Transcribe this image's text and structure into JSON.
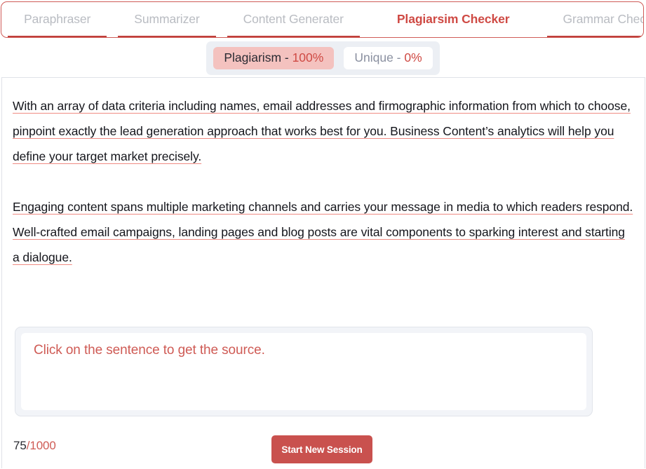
{
  "tabs": [
    {
      "label": "Paraphraser",
      "active": false
    },
    {
      "label": "Summarizer",
      "active": false
    },
    {
      "label": "Content Generater",
      "active": false
    },
    {
      "label": "Plagiarsim Checker",
      "active": true
    },
    {
      "label": "Grammar Checker",
      "active": false
    }
  ],
  "scores": {
    "plagiarism_label": "Plagiarism - ",
    "plagiarism_value": "100%",
    "unique_label": "Unique - ",
    "unique_value": "0%"
  },
  "document": {
    "paragraphs": [
      "With an array of data criteria including names, email addresses and firmographic information from which to choose, pinpoint exactly the lead generation approach that works best for you. Business Content’s analytics will help you define your target market precisely.",
      "Engaging content spans multiple marketing channels and carries your message in media to which readers respond. Well-crafted email campaigns, landing pages and blog posts are vital components to sparking interest and starting a dialogue."
    ]
  },
  "source_panel": {
    "placeholder": "Click on the sentence to get the source."
  },
  "footer": {
    "char_count": "75",
    "char_limit": "/1000",
    "new_session_label": "Start New Session"
  },
  "colors": {
    "accent_red": "#cf4a44",
    "button_red": "#c9514e",
    "highlight_underline": "#ef8b83",
    "plagiarism_badge_bg": "#f4c2bf",
    "panel_bg": "#f2f4f8",
    "muted_text": "#b9bcc2"
  }
}
